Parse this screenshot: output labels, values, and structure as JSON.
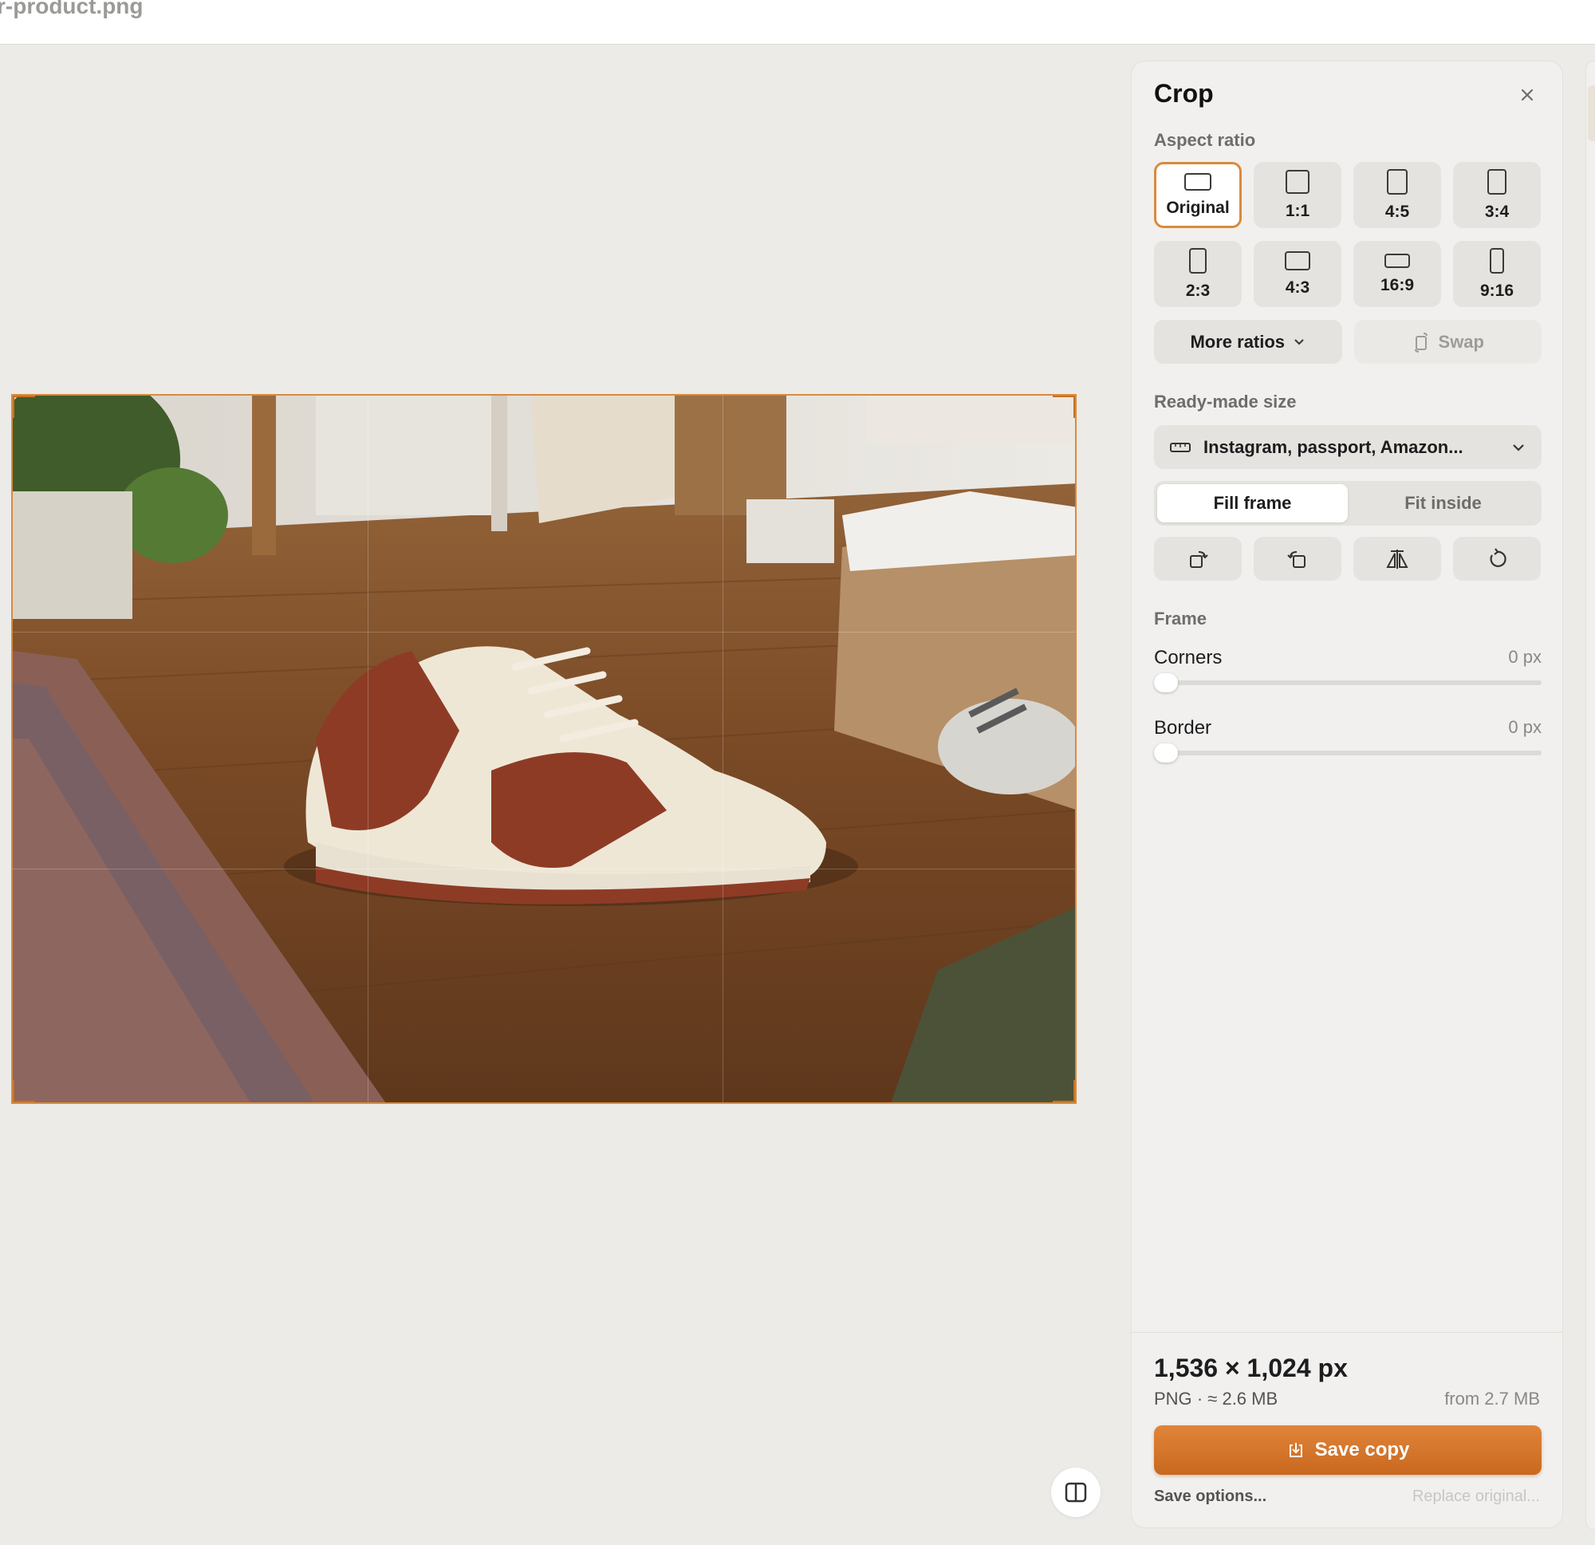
{
  "window": {
    "filename": "r-product.png"
  },
  "panel": {
    "title": "Crop",
    "aspect_ratio_label": "Aspect ratio",
    "ratios": [
      {
        "label": "Original",
        "selected": true
      },
      {
        "label": "1:1"
      },
      {
        "label": "4:5"
      },
      {
        "label": "3:4"
      },
      {
        "label": "2:3"
      },
      {
        "label": "4:3"
      },
      {
        "label": "16:9"
      },
      {
        "label": "9:16"
      }
    ],
    "more_ratios": "More ratios",
    "swap": "Swap",
    "ready_made_label": "Ready-made size",
    "ready_made_value": "Instagram, passport, Amazon...",
    "fill_modes": {
      "fill": "Fill frame",
      "fit": "Fit inside",
      "active": "fill"
    },
    "frame_label": "Frame",
    "corners": {
      "label": "Corners",
      "value": "0 px"
    },
    "border": {
      "label": "Border",
      "value": "0 px"
    },
    "output": {
      "dimensions": "1,536 × 1,024 px",
      "format": "PNG",
      "size": "≈ 2.6 MB",
      "from": "from 2.7 MB"
    },
    "save_copy": "Save copy",
    "save_options": "Save options...",
    "replace_original": "Replace original..."
  },
  "colors": {
    "accent": "#d98a3d",
    "save_button": "#d4752b",
    "panel_bg": "#f1f0ee",
    "canvas_bg": "#ecebe8"
  }
}
